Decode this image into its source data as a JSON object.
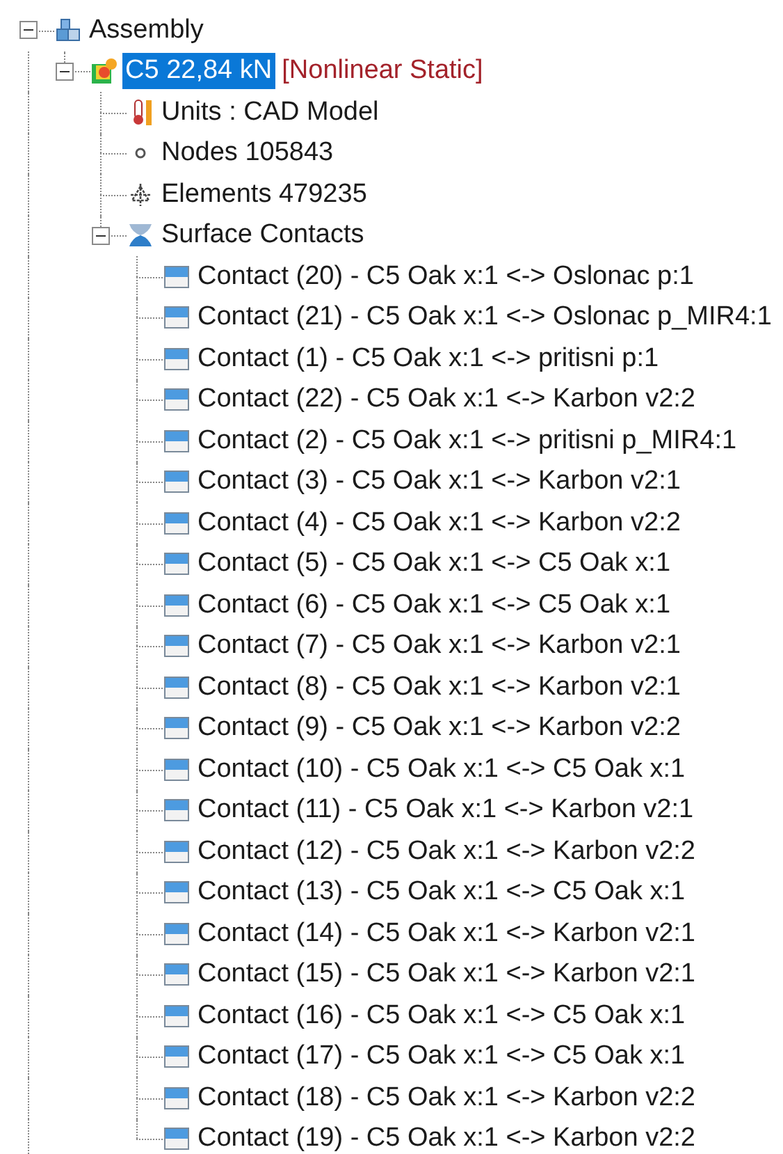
{
  "tree": [
    {
      "label": "Assembly",
      "kind": "assembly",
      "selected": false,
      "expanded": true,
      "children": [
        {
          "label": "C5 22,84 kN",
          "tag": "[Nonlinear Static]",
          "kind": "study",
          "selected": true,
          "expanded": true,
          "children": [
            {
              "label": "Units : CAD Model",
              "kind": "units",
              "selected": false
            },
            {
              "label": "Nodes 105843",
              "kind": "nodes",
              "selected": false
            },
            {
              "label": "Elements 479235",
              "kind": "elements",
              "selected": false
            },
            {
              "label": "Surface Contacts",
              "kind": "contacts",
              "selected": false,
              "expanded": true,
              "children": [
                {
                  "label": "Contact (20) - C5 Oak x:1 <-> Oslonac p:1",
                  "kind": "contact",
                  "selected": false
                },
                {
                  "label": "Contact (21) - C5 Oak x:1 <-> Oslonac p_MIR4:1",
                  "kind": "contact",
                  "selected": false
                },
                {
                  "label": "Contact (1) - C5 Oak x:1 <-> pritisni p:1",
                  "kind": "contact",
                  "selected": false
                },
                {
                  "label": "Contact (22) - C5 Oak x:1 <-> Karbon v2:2",
                  "kind": "contact",
                  "selected": false
                },
                {
                  "label": "Contact (2) - C5 Oak x:1 <-> pritisni p_MIR4:1",
                  "kind": "contact",
                  "selected": false
                },
                {
                  "label": "Contact (3) - C5 Oak x:1 <-> Karbon v2:1",
                  "kind": "contact",
                  "selected": false
                },
                {
                  "label": "Contact (4) - C5 Oak x:1 <-> Karbon v2:2",
                  "kind": "contact",
                  "selected": false
                },
                {
                  "label": "Contact (5) - C5 Oak x:1 <-> C5 Oak x:1",
                  "kind": "contact",
                  "selected": false
                },
                {
                  "label": "Contact (6) - C5 Oak x:1 <-> C5 Oak x:1",
                  "kind": "contact",
                  "selected": false
                },
                {
                  "label": "Contact (7) - C5 Oak x:1 <-> Karbon v2:1",
                  "kind": "contact",
                  "selected": false
                },
                {
                  "label": "Contact (8) - C5 Oak x:1 <-> Karbon v2:1",
                  "kind": "contact",
                  "selected": false
                },
                {
                  "label": "Contact (9) - C5 Oak x:1 <-> Karbon v2:2",
                  "kind": "contact",
                  "selected": false
                },
                {
                  "label": "Contact (10) - C5 Oak x:1 <-> C5 Oak x:1",
                  "kind": "contact",
                  "selected": false
                },
                {
                  "label": "Contact (11) - C5 Oak x:1 <-> Karbon v2:1",
                  "kind": "contact",
                  "selected": false
                },
                {
                  "label": "Contact (12) - C5 Oak x:1 <-> Karbon v2:2",
                  "kind": "contact",
                  "selected": false
                },
                {
                  "label": "Contact (13) - C5 Oak x:1 <-> C5 Oak x:1",
                  "kind": "contact",
                  "selected": false
                },
                {
                  "label": "Contact (14) - C5 Oak x:1 <-> Karbon v2:1",
                  "kind": "contact",
                  "selected": false
                },
                {
                  "label": "Contact (15) - C5 Oak x:1 <-> Karbon v2:1",
                  "kind": "contact",
                  "selected": false
                },
                {
                  "label": "Contact (16) - C5 Oak x:1 <-> C5 Oak x:1",
                  "kind": "contact",
                  "selected": false
                },
                {
                  "label": "Contact (17) - C5 Oak x:1 <-> C5 Oak x:1",
                  "kind": "contact",
                  "selected": false
                },
                {
                  "label": "Contact (18) - C5 Oak x:1 <-> Karbon v2:2",
                  "kind": "contact",
                  "selected": false
                },
                {
                  "label": "Contact (19) - C5 Oak x:1 <-> Karbon v2:2",
                  "kind": "contact",
                  "selected": false
                }
              ]
            }
          ]
        }
      ]
    }
  ]
}
